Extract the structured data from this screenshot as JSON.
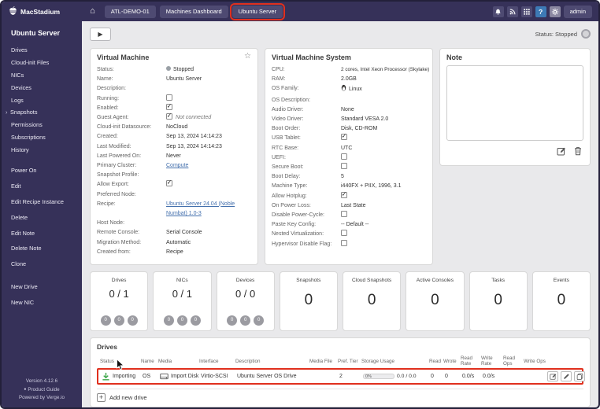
{
  "colors": {
    "topbar_bg": "#363159",
    "nav_button_bg": "#4e4a72",
    "help_button_bg": "#3d7ab5",
    "annotation_red": "#e0301e",
    "link_blue": "#4470ad",
    "importing_green": "#3ca648",
    "badge_gray": "#9b9ba1"
  },
  "icons": {
    "home": "⌂",
    "play": "▶",
    "star": "☆",
    "snapshots_chevron": "›",
    "add_plus": "+",
    "help": "?",
    "guide_bullet": "●"
  },
  "topbar": {
    "brand": "MacStadium",
    "nav": [
      {
        "label": "ATL-DEMO-01"
      },
      {
        "label": "Machines Dashboard"
      },
      {
        "label": "Ubuntu Server"
      }
    ],
    "admin_label": "admin"
  },
  "sidebar": {
    "title": "Ubuntu Server",
    "nav_items": [
      {
        "label": "Drives"
      },
      {
        "label": "Cloud-init Files"
      },
      {
        "label": "NICs"
      },
      {
        "label": "Devices"
      },
      {
        "label": "Logs"
      },
      {
        "label": "Snapshots"
      },
      {
        "label": "Permissions"
      },
      {
        "label": "Subscriptions"
      },
      {
        "label": "History"
      }
    ],
    "action_items": [
      {
        "label": "Power On"
      },
      {
        "label": "Edit"
      },
      {
        "label": "Edit Recipe Instance"
      },
      {
        "label": "Delete"
      },
      {
        "label": "Edit Note"
      },
      {
        "label": "Delete Note"
      },
      {
        "label": "Clone"
      }
    ],
    "create_items": [
      {
        "label": "New Drive"
      },
      {
        "label": "New NIC"
      }
    ],
    "footer": {
      "version": "Version 4.12.6",
      "guide": "Product Guide",
      "powered": "Powered by Verge.io"
    }
  },
  "toolbar": {
    "status_label": "Status: Stopped"
  },
  "vm_panel": {
    "title": "Virtual Machine",
    "fields": {
      "status": {
        "label": "Status:",
        "value": "Stopped"
      },
      "name": {
        "label": "Name:",
        "value": "Ubuntu Server"
      },
      "description": {
        "label": "Description:",
        "value": ""
      },
      "running": {
        "label": "Running:",
        "checked": false
      },
      "enabled": {
        "label": "Enabled:",
        "checked": true
      },
      "guest_agent": {
        "label": "Guest Agent:",
        "checked": true,
        "note": "Not connected"
      },
      "cloud_init": {
        "label": "Cloud-init Datasource:",
        "value": "NoCloud"
      },
      "created": {
        "label": "Created:",
        "value": "Sep 13, 2024 14:14:23"
      },
      "last_modified": {
        "label": "Last Modified:",
        "value": "Sep 13, 2024 14:14:23"
      },
      "last_powered_on": {
        "label": "Last Powered On:",
        "value": "Never"
      },
      "primary_cluster": {
        "label": "Primary Cluster:",
        "value": "Compute"
      },
      "snapshot_profile": {
        "label": "Snapshot Profile:",
        "value": ""
      },
      "allow_export": {
        "label": "Allow Export:",
        "checked": true
      },
      "preferred_node": {
        "label": "Preferred Node:",
        "value": ""
      },
      "recipe": {
        "label": "Recipe:",
        "value": "Ubuntu Server 24.04 (Noble Numbat) 1.0-3"
      },
      "host_node": {
        "label": "Host Node:",
        "value": ""
      },
      "remote_console": {
        "label": "Remote Console:",
        "value": "Serial Console"
      },
      "migration_method": {
        "label": "Migration Method:",
        "value": "Automatic"
      },
      "created_from": {
        "label": "Created from:",
        "value": "Recipe"
      }
    }
  },
  "system_panel": {
    "title": "Virtual Machine System",
    "fields": {
      "cpu": {
        "label": "CPU:",
        "value": "2 cores, Intel Xeon Processor (Skylake)"
      },
      "ram": {
        "label": "RAM:",
        "value": "2.0GB"
      },
      "os_family": {
        "label": "OS Family:",
        "value": "Linux"
      },
      "os_description": {
        "label": "OS Description:",
        "value": ""
      },
      "audio_driver": {
        "label": "Audio Driver:",
        "value": "None"
      },
      "video_driver": {
        "label": "Video Driver:",
        "value": "Standard VESA 2.0"
      },
      "boot_order": {
        "label": "Boot Order:",
        "value": "Disk, CD-ROM"
      },
      "usb_tablet": {
        "label": "USB Tablet:",
        "checked": true
      },
      "rtc_base": {
        "label": "RTC Base:",
        "value": "UTC"
      },
      "uefi": {
        "label": "UEFI:",
        "checked": false
      },
      "secure_boot": {
        "label": "Secure Boot:",
        "checked": false
      },
      "boot_delay": {
        "label": "Boot Delay:",
        "value": "5"
      },
      "machine_type": {
        "label": "Machine Type:",
        "value": "i440FX + PIIX, 1996, 3.1"
      },
      "allow_hotplug": {
        "label": "Allow Hotplug:",
        "checked": true
      },
      "on_power_loss": {
        "label": "On Power Loss:",
        "value": "Last State"
      },
      "disable_power_cycle": {
        "label": "Disable Power-Cycle:",
        "checked": false
      },
      "paste_key_config": {
        "label": "Paste Key Config:",
        "value": "-- Default --"
      },
      "nested_virtualization": {
        "label": "Nested Virtualization:",
        "checked": false
      },
      "hypervisor_disable_flag": {
        "label": "Hypervisor Disable Flag:",
        "checked": false
      }
    }
  },
  "note_panel": {
    "title": "Note",
    "content": ""
  },
  "stat_cards": [
    {
      "label": "Drives",
      "value": "0 / 1",
      "badges": [
        "0",
        "0",
        "0"
      ]
    },
    {
      "label": "NICs",
      "value": "0 / 1",
      "badges": [
        "0",
        "0",
        "0"
      ]
    },
    {
      "label": "Devices",
      "value": "0 / 0",
      "badges": [
        "0",
        "0",
        "0"
      ]
    },
    {
      "label": "Snapshots",
      "value": "0"
    },
    {
      "label": "Cloud Snapshots",
      "value": "0"
    },
    {
      "label": "Active Consoles",
      "value": "0"
    },
    {
      "label": "Tasks",
      "value": "0"
    },
    {
      "label": "Events",
      "value": "0"
    }
  ],
  "drives_panel": {
    "title": "Drives",
    "headers": [
      "Status",
      "Name",
      "Media",
      "Interface",
      "Description",
      "Media File",
      "Pref. Tier",
      "Storage Usage",
      "Read",
      "Wrote",
      "Read Rate",
      "Write Rate",
      "Read Ops",
      "Write Ops"
    ],
    "row": {
      "status": "Importing",
      "name": "OS",
      "media": "Import Disk",
      "interface": "Virtio-SCSI",
      "description": "Ubuntu Server OS Drive",
      "media_file": "",
      "pref_tier": "2",
      "usage_percent": "0%",
      "usage_detail": "0.0 / 0.0",
      "read": "0",
      "wrote": "0",
      "read_rate": "0.0/s",
      "write_rate": "0.0/s",
      "read_ops": "",
      "write_ops": ""
    },
    "add_label": "Add new drive"
  }
}
